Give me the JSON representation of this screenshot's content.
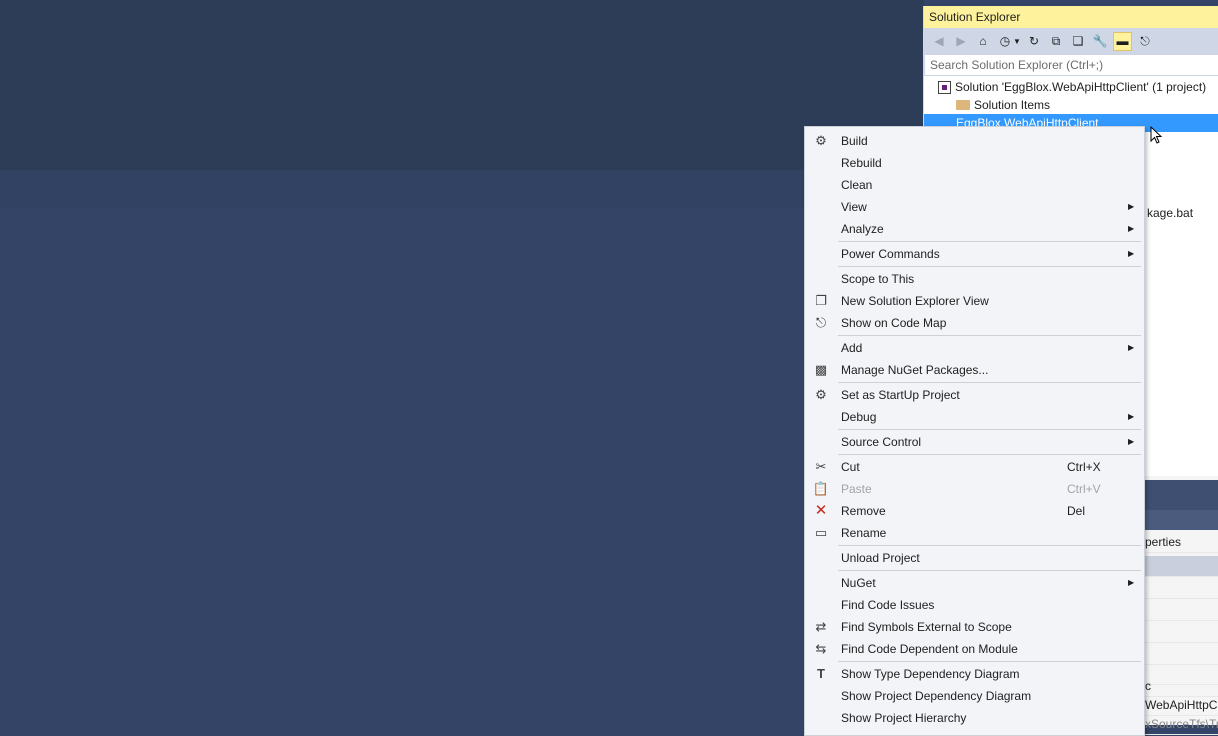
{
  "solution_explorer": {
    "title": "Solution Explorer",
    "search_placeholder": "Search Solution Explorer (Ctrl+;)",
    "tree": {
      "solution": "Solution 'EggBlox.WebApiHttpClient' (1 project)",
      "solution_items": "Solution Items",
      "project": "EggBlox.WebApiHttpClient",
      "partial_file": "kage.bat"
    }
  },
  "properties": {
    "partial_rows": [
      "perties",
      "",
      "",
      "",
      "",
      "",
      "",
      "c",
      "WebApiHttpCl",
      "xSourceTfs\\Tr"
    ]
  },
  "context_menu": {
    "items": [
      {
        "label": "Build",
        "icon": "build-icon"
      },
      {
        "label": "Rebuild"
      },
      {
        "label": "Clean"
      },
      {
        "label": "View",
        "submenu": true
      },
      {
        "label": "Analyze",
        "submenu": true
      },
      {
        "label": "Power Commands",
        "submenu": true
      },
      {
        "label": "Scope to This"
      },
      {
        "label": "New Solution Explorer View",
        "icon": "new-view-icon"
      },
      {
        "label": "Show on Code Map",
        "icon": "code-map-icon"
      },
      {
        "label": "Add",
        "submenu": true
      },
      {
        "label": "Manage NuGet Packages...",
        "icon": "nuget-icon"
      },
      {
        "label": "Set as StartUp Project",
        "icon": "gear-icon"
      },
      {
        "label": "Debug",
        "submenu": true
      },
      {
        "label": "Source Control",
        "submenu": true
      },
      {
        "label": "Cut",
        "icon": "scissors-icon",
        "shortcut": "Ctrl+X"
      },
      {
        "label": "Paste",
        "icon": "clipboard-icon",
        "shortcut": "Ctrl+V",
        "disabled": true
      },
      {
        "label": "Remove",
        "icon": "remove-icon",
        "shortcut": "Del"
      },
      {
        "label": "Rename",
        "icon": "rename-icon"
      },
      {
        "label": "Unload Project"
      },
      {
        "label": "NuGet",
        "submenu": true
      },
      {
        "label": "Find Code Issues"
      },
      {
        "label": "Find Symbols External to Scope",
        "icon": "find-symbols-icon"
      },
      {
        "label": "Find Code Dependent on Module",
        "icon": "find-dependent-icon"
      },
      {
        "label": "Show Type Dependency Diagram",
        "icon": "type-diagram-icon"
      },
      {
        "label": "Show Project Dependency Diagram"
      },
      {
        "label": "Show Project Hierarchy"
      }
    ]
  }
}
